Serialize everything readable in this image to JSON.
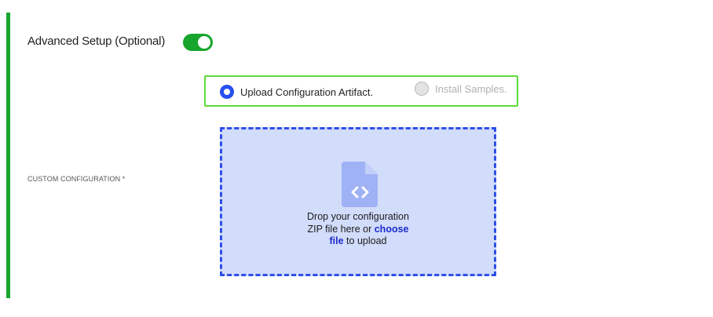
{
  "section": {
    "title": "Advanced Setup (Optional)",
    "toggle_on": true
  },
  "config_source": {
    "options": [
      {
        "label": "Upload Configuration Artifact.",
        "selected": true,
        "disabled": false
      },
      {
        "label": "Install Samples.",
        "selected": false,
        "disabled": true
      }
    ]
  },
  "custom_config": {
    "label": "CUSTOM CONFIGURATION *",
    "dropzone": {
      "line1": "Drop your configuration",
      "line2_prefix": "ZIP file here or",
      "choose_part1": "choose",
      "choose_part2": "file",
      "suffix": "to upload",
      "icon": "file-code-icon"
    }
  },
  "colors": {
    "accent_green": "#17a52e",
    "radio_blue": "#2650f0",
    "dropzone_bg": "#d2dcfb",
    "dropzone_border": "#2d4fe8",
    "link_blue": "#1b2bc9"
  }
}
